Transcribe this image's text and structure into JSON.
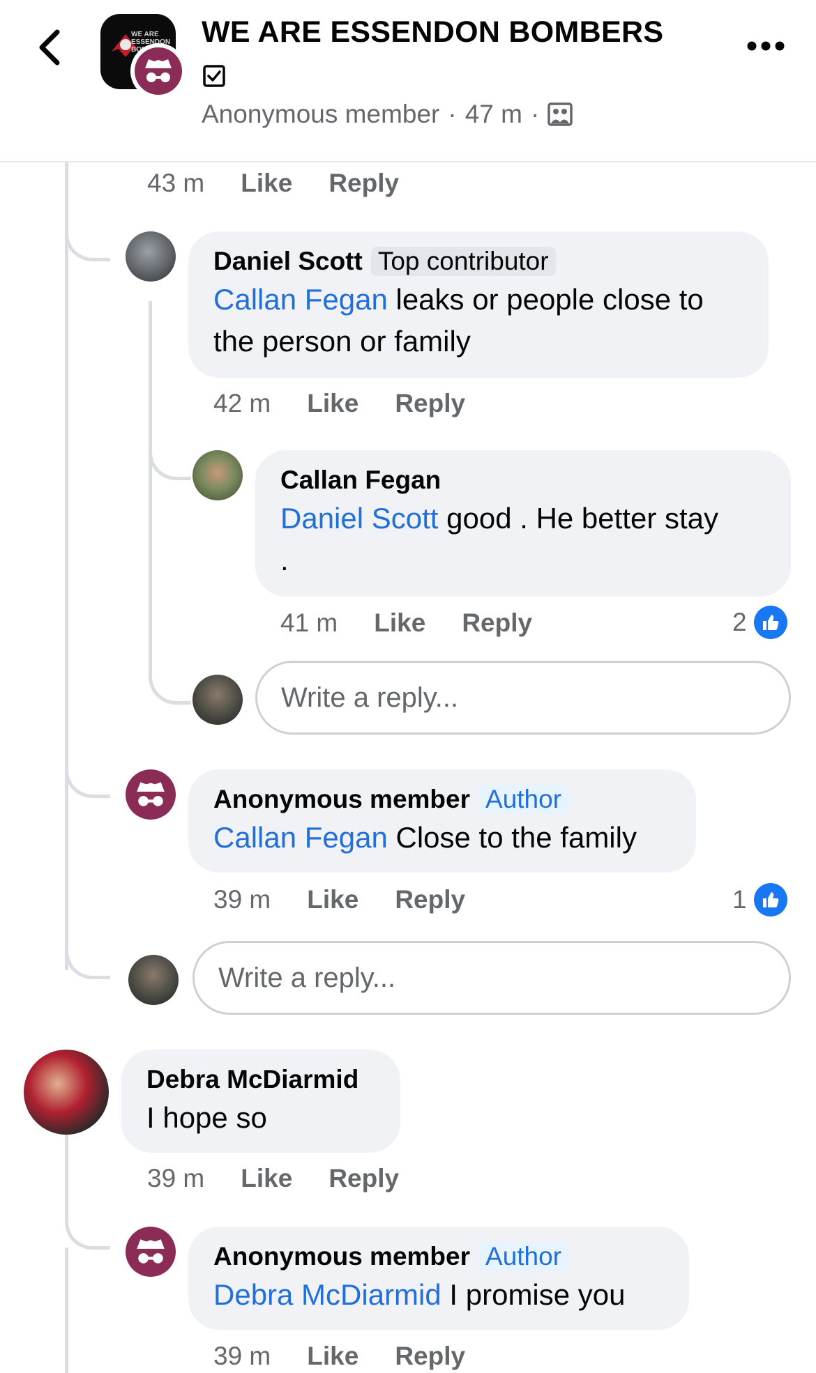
{
  "header": {
    "group_name": "WE ARE ESSENDON BOMBERS",
    "logo_text": "WE ARE ESSENDON BOMBERS",
    "author": "Anonymous member",
    "time": "47 m",
    "separator": "·"
  },
  "top_actions": {
    "time": "43 m",
    "like": "Like",
    "reply": "Reply"
  },
  "comments": [
    {
      "name": "Daniel Scott",
      "badge": "Top contributor",
      "mention": "Callan Fegan",
      "line1": " leaks or people close to",
      "line2": "the person or family",
      "time": "42 m",
      "like": "Like",
      "reply": "Reply"
    },
    {
      "name": "Callan Fegan",
      "mention": "Daniel Scott",
      "line1": " good . He better stay",
      "line2": ".",
      "time": "41 m",
      "like": "Like",
      "reply": "Reply",
      "reactions": "2"
    },
    {
      "name": "Anonymous member",
      "badge": "Author",
      "mention": "Callan Fegan",
      "line1": " Close to the family",
      "time": "39 m",
      "like": "Like",
      "reply": "Reply",
      "reactions": "1"
    },
    {
      "name": "Debra McDiarmid",
      "line1": "I hope so",
      "time": "39 m",
      "like": "Like",
      "reply": "Reply"
    },
    {
      "name": "Anonymous member",
      "badge": "Author",
      "mention": "Debra McDiarmid",
      "line1": " I promise you",
      "time": "39 m",
      "like": "Like",
      "reply": "Reply"
    }
  ],
  "reply_placeholder": "Write a reply...",
  "colors": {
    "mention": "#216fdb",
    "bubble": "#f0f2f5",
    "anon": "#8a2c55",
    "like": "#1877f2"
  }
}
